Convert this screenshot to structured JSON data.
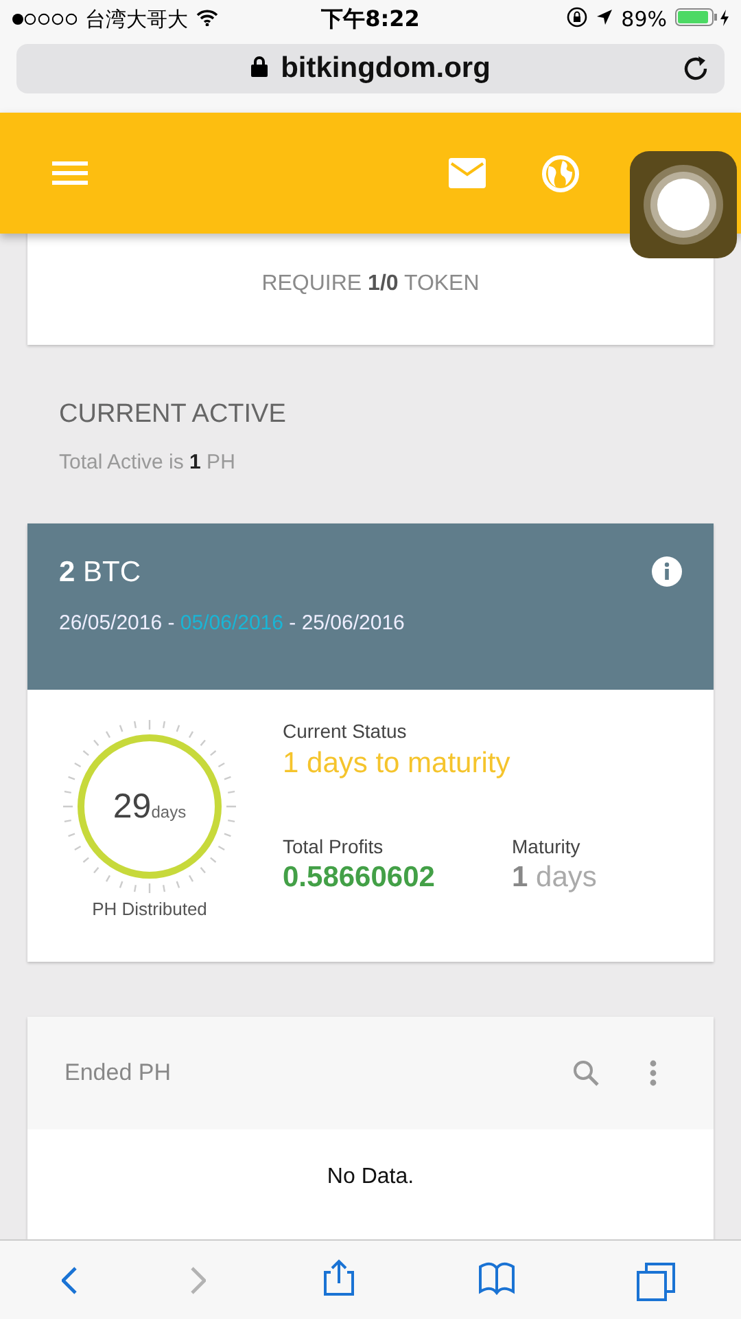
{
  "status_bar": {
    "carrier": "台湾大哥大",
    "time": "下午8:22",
    "battery": "89%"
  },
  "url_bar": {
    "url": "bitkingdom.org"
  },
  "token_card": {
    "text": "REQUIRE **1/0** TOKEN"
  },
  "current_active": {
    "title": "CURRENT ACTIVE",
    "summary": "Total Active is **1** PH"
  },
  "contract": {
    "amount": "**2** BTC",
    "dates": [
      {
        "text": "26/05/2016 - ",
        "highlight": false
      },
      {
        "text": "05/06/2016",
        "highlight": true
      },
      {
        "text": " - 25/06/2016",
        "highlight": false
      }
    ],
    "gauge": {
      "value": "29",
      "unit": "days",
      "label": "PH Distributed"
    },
    "status_label": "Current Status",
    "status_value": "1 days to maturity",
    "profits_label": "Total Profits",
    "profits_value": "0.58660602",
    "maturity_label": "Maturity",
    "maturity_value": "**1** days"
  },
  "ended": {
    "title": "Ended PH",
    "empty": "No Data."
  },
  "toolbar": [
    {
      "kind": "back",
      "disabled": false
    },
    {
      "kind": "forward",
      "disabled": true
    },
    {
      "kind": "share",
      "disabled": false
    },
    {
      "kind": "bookmarks",
      "disabled": false
    },
    {
      "kind": "tabs",
      "disabled": false
    }
  ]
}
